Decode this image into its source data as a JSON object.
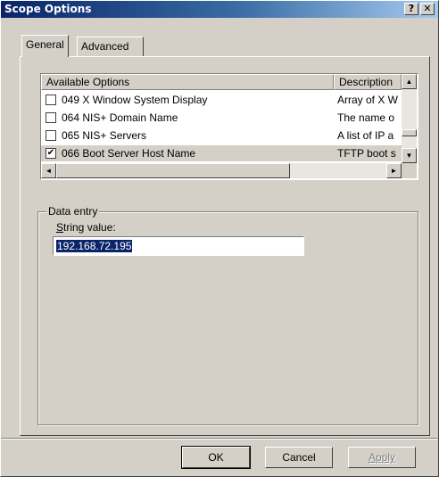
{
  "window": {
    "title": "Scope Options",
    "help_label": "?",
    "close_label": "✕"
  },
  "tabs": [
    {
      "label": "General"
    },
    {
      "label": "Advanced"
    }
  ],
  "options_list": {
    "columns": [
      "Available Options",
      "Description"
    ],
    "rows": [
      {
        "checked": false,
        "option": "049 X Window System Display",
        "description": "Array of X W"
      },
      {
        "checked": false,
        "option": "064 NIS+ Domain Name",
        "description": "The name o"
      },
      {
        "checked": false,
        "option": "065 NIS+ Servers",
        "description": "A list of IP a"
      },
      {
        "checked": true,
        "option": "066 Boot Server Host Name",
        "description": "TFTP boot s"
      }
    ],
    "checked_mark": "✔"
  },
  "data_entry": {
    "group_label": "Data entry",
    "field_label_prefix": "S",
    "field_label_rest": "tring value:",
    "value": "192.168.72.195"
  },
  "buttons": {
    "ok": "OK",
    "cancel": "Cancel",
    "apply": "Apply"
  },
  "icons": {
    "scroll_up": "▲",
    "scroll_down": "▼",
    "scroll_left": "◄",
    "scroll_right": "►"
  },
  "colors": {
    "title_start": "#0a246a",
    "title_end": "#a6caf0",
    "selection": "#0a246a",
    "face": "#d4d0c8"
  }
}
